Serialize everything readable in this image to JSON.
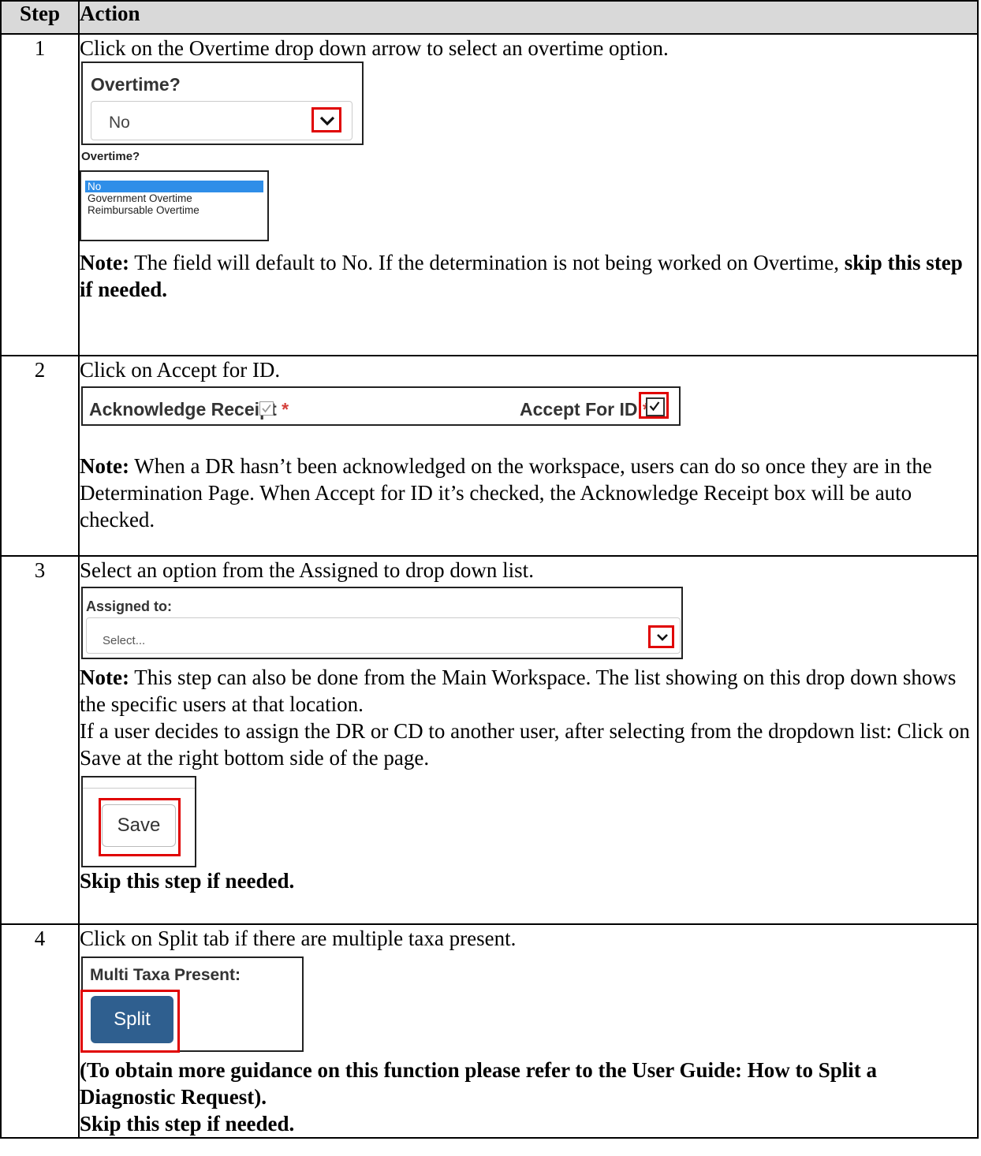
{
  "table": {
    "headers": {
      "step": "Step",
      "action": "Action"
    }
  },
  "steps": [
    {
      "num": "1",
      "instruction": "Click on the Overtime drop down arrow to select an overtime option.",
      "overtime_label": "Overtime?",
      "overtime_value": "No",
      "overtime_list_label": "Overtime?",
      "overtime_options": [
        "No",
        "Government Overtime",
        "Reimbursable Overtime"
      ],
      "note_label": "Note:",
      "note_text": " The field will default to No. If the determination is not being worked on Overtime, ",
      "note_bold": "skip this step if needed."
    },
    {
      "num": "2",
      "instruction": "Click on Accept for ID.",
      "ack_label": "Acknowledge Receipt",
      "accept_label": "Accept For ID",
      "required_mark": "*",
      "note_label": "Note:",
      "note_text": " When a DR hasn’t been acknowledged on the workspace, users can do so once they are in the Determination Page. When Accept for ID it’s checked, the Acknowledge Receipt box will be auto checked."
    },
    {
      "num": "3",
      "instruction": "Select an option from the Assigned to drop down list.",
      "assigned_label": "Assigned to:",
      "assigned_placeholder": "Select...",
      "note_label": "Note:",
      "note_text": " This step can also be done from the Main Workspace. The list showing on this drop down shows the specific users at that location.",
      "extra_text": "If a user decides to assign the DR or CD to another user, after selecting from the dropdown list: Click on Save at the right bottom side of the page.",
      "save_label": "Save",
      "skip_text": "Skip this step if needed."
    },
    {
      "num": "4",
      "instruction": "Click on Split tab if there are multiple taxa present.",
      "multi_label": "Multi Taxa Present:",
      "split_label": "Split",
      "guidance": "(To obtain more guidance on this function please refer to the User Guide: How to Split a Diagnostic Request).",
      "skip_text": "Skip this step if needed."
    }
  ]
}
